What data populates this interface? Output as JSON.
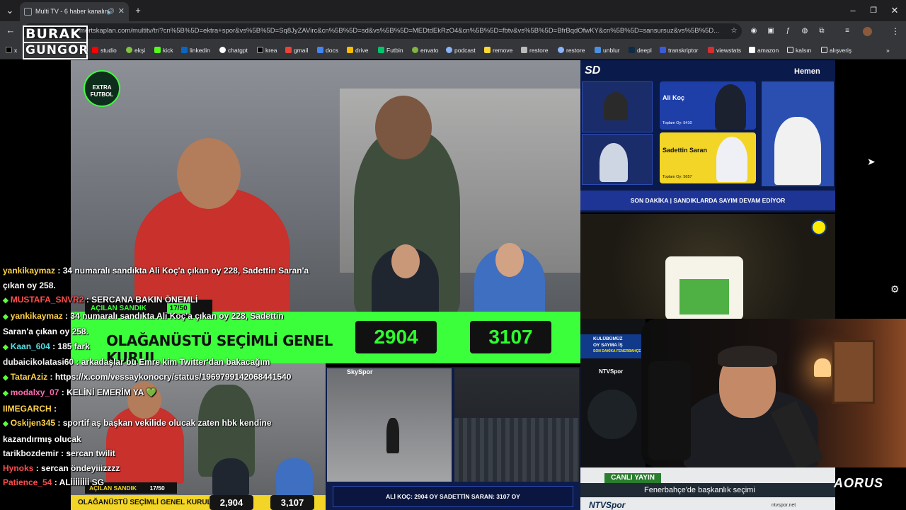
{
  "browser": {
    "tab_title": "Multi TV - 6 haber kanalını",
    "url": "mertskaplan.com/multitv/tr/?cn%5B%5D=ektra+spor&vs%5B%5D=Sq8JyZAVirc&cn%5B%5D=sd&vs%5B%5D=MEDtdEkRzO4&cn%5B%5D=fbtv&vs%5B%5D=BfrBqdOfwKY&cn%5B%5D=sansursuz&vs%5B%5D...",
    "bookmarks": [
      "x",
      "studio",
      "ekşi",
      "kick",
      "linkedin",
      "chatgpt",
      "krea",
      "gmail",
      "docs",
      "drive",
      "Futbin",
      "envato",
      "podcast",
      "remove",
      "restore",
      "restore",
      "unblur",
      "deepl",
      "transkriptor",
      "viewstats",
      "amazon",
      "kalsın",
      "alışveriş"
    ],
    "colors": {
      "chrome_dark": "#1f1f22",
      "chrome": "#35363a",
      "score_green": "#2dff2d",
      "banner_green": "#3cff3c"
    }
  },
  "overlay": {
    "logo_line1": "BURAK",
    "logo_line2": "GUNGOR",
    "aorus": "AORUS"
  },
  "streams": {
    "main": {
      "channel_logo": "EXTRA FUTBOL",
      "box_label": "AÇILAN SANDIK",
      "box_count": "17/50",
      "banner": "OLAĞANÜSTÜ SEÇİMLİ GENEL KURUL",
      "score_left": "2904",
      "score_right": "3107"
    },
    "sd": {
      "logo": "SD",
      "brand": "Hemen",
      "candidate1_name": "Ali Koç",
      "candidate1_votes": "Toplam Oy: 5410",
      "candidate2_name": "Sadettin Saran",
      "candidate2_votes": "Toplam Oy: 5657",
      "ticker": "SON DAKİKA | SANDIKLARDA SAYIM DEVAM EDİYOR"
    },
    "fb": {
      "ticker_line1": "KULÜBÜMÜZ",
      "ticker_line2": "OY SAYMA İŞ",
      "ticker_line3": "SON DAKİKA   FENERBAHÇE"
    },
    "ntv": {
      "logo": "NTVSpor",
      "live": "CANLI YAYIN",
      "headline": "Fenerbahçe'de başkanlık seçimi",
      "url": "ntvspor.net",
      "brand": "NTVSpor"
    },
    "small_main": {
      "box_label": "AÇILAN SANDIK",
      "box_count": "17/50",
      "banner": "OLAĞANÜSTÜ SEÇİMLİ GENEL KURUL",
      "score_left": "2,904",
      "score_right": "3,107"
    },
    "skyspor": {
      "logo": "SkySpor",
      "ticker": "ALİ KOÇ: 2904 OY SADETTİN SARAN: 3107 OY"
    }
  },
  "chat": [
    {
      "user": "yankikaymaz",
      "text": ": 34 numaralı sandıkta Ali Koç'a çıkan oy 228, Sadettin Saran'a çıkan oy 258.",
      "color": "u-yellow",
      "badge": false
    },
    {
      "user": "MUSTAFA_SNVR2",
      "text": ": SERCANA BAKIN ÖNEMLİ",
      "color": "u-red",
      "badge": true
    },
    {
      "user": "yankikaymaz",
      "text": ": 34 numaralı sandıkta Ali Koç'a çıkan oy 228, Sadettin Saran'a çıkan oy 258.",
      "color": "u-yellow",
      "badge": true
    },
    {
      "user": "Kaan_604",
      "text": ": 185 fark",
      "color": "u-cyan",
      "badge": true
    },
    {
      "user": "dubaicikolatasi60",
      "text": ": arkadaşlar bu Emre kim Twitter'dan bakacağım",
      "color": "u-white",
      "badge": false
    },
    {
      "user": "TatarAziz",
      "text": ": https://x.com/vessaykonocry/status/1969799142068441540",
      "color": "u-yellow",
      "badge": true
    },
    {
      "user": "modalxy_07",
      "text": ": KELİNİ EMERİM YA 💚",
      "color": "u-pink",
      "badge": true
    },
    {
      "user": "IIMEGARCH",
      "text": ":",
      "color": "u-yellow",
      "badge": false
    },
    {
      "user": "Oskijen345",
      "text": ": sportif aş başkan vekilide olucak zaten hbk kendine kazandırmış olucak",
      "color": "u-yellow",
      "badge": true
    },
    {
      "user": "tarikbozdemir",
      "text": ": sercan twilit",
      "color": "u-white",
      "badge": false
    },
    {
      "user": "Hynoks",
      "text": ": sercan öndeyiiizzzz",
      "color": "u-red",
      "badge": false
    },
    {
      "user": "Patience_54",
      "text": ": ALİİİİİİİİ SG",
      "color": "u-red",
      "badge": false
    }
  ]
}
